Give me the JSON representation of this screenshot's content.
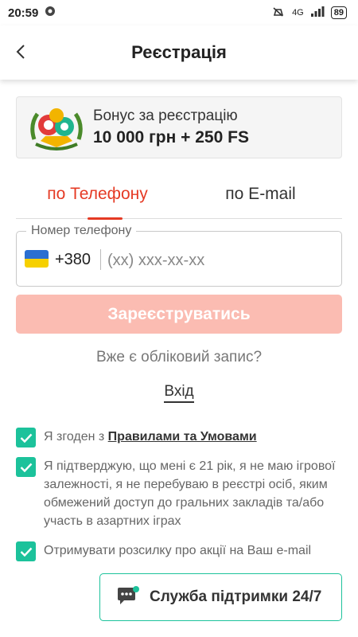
{
  "statusbar": {
    "time": "20:59",
    "battery": "89",
    "network": "4G"
  },
  "header": {
    "title": "Реєстрація"
  },
  "bonus": {
    "line1": "Бонус за реєстрацію",
    "line2": "10 000 грн + 250 FS"
  },
  "tabs": [
    {
      "label": "по Телефону",
      "active": true
    },
    {
      "label": "по E-mail",
      "active": false
    }
  ],
  "phone": {
    "legend": "Номер телефону",
    "code": "+380",
    "placeholder": "(xx) xxx-xx-xx",
    "value": ""
  },
  "register_button": "Зареєструватись",
  "have_account": "Вже є обліковий запис?",
  "login_link": "Вхід",
  "checkboxes": [
    {
      "prefix": "Я згоден з ",
      "link": "Правилами та Умовами",
      "checked": true
    },
    {
      "text": "Я підтверджую, що мені є 21 рік, я не маю ігрової залежності, я не перебуваю в реєстрі осіб, яким обмежений доступ до гральних закладів та/або участь в азартних іграх",
      "checked": true
    },
    {
      "text": "Отримувати розсилку про акції на Ваш e-mail",
      "checked": true
    }
  ],
  "support": {
    "label": "Служба підтримки 24/7"
  },
  "colors": {
    "accent": "#e53a24",
    "accent_light": "#fbbcb2",
    "teal": "#1cc29b"
  }
}
